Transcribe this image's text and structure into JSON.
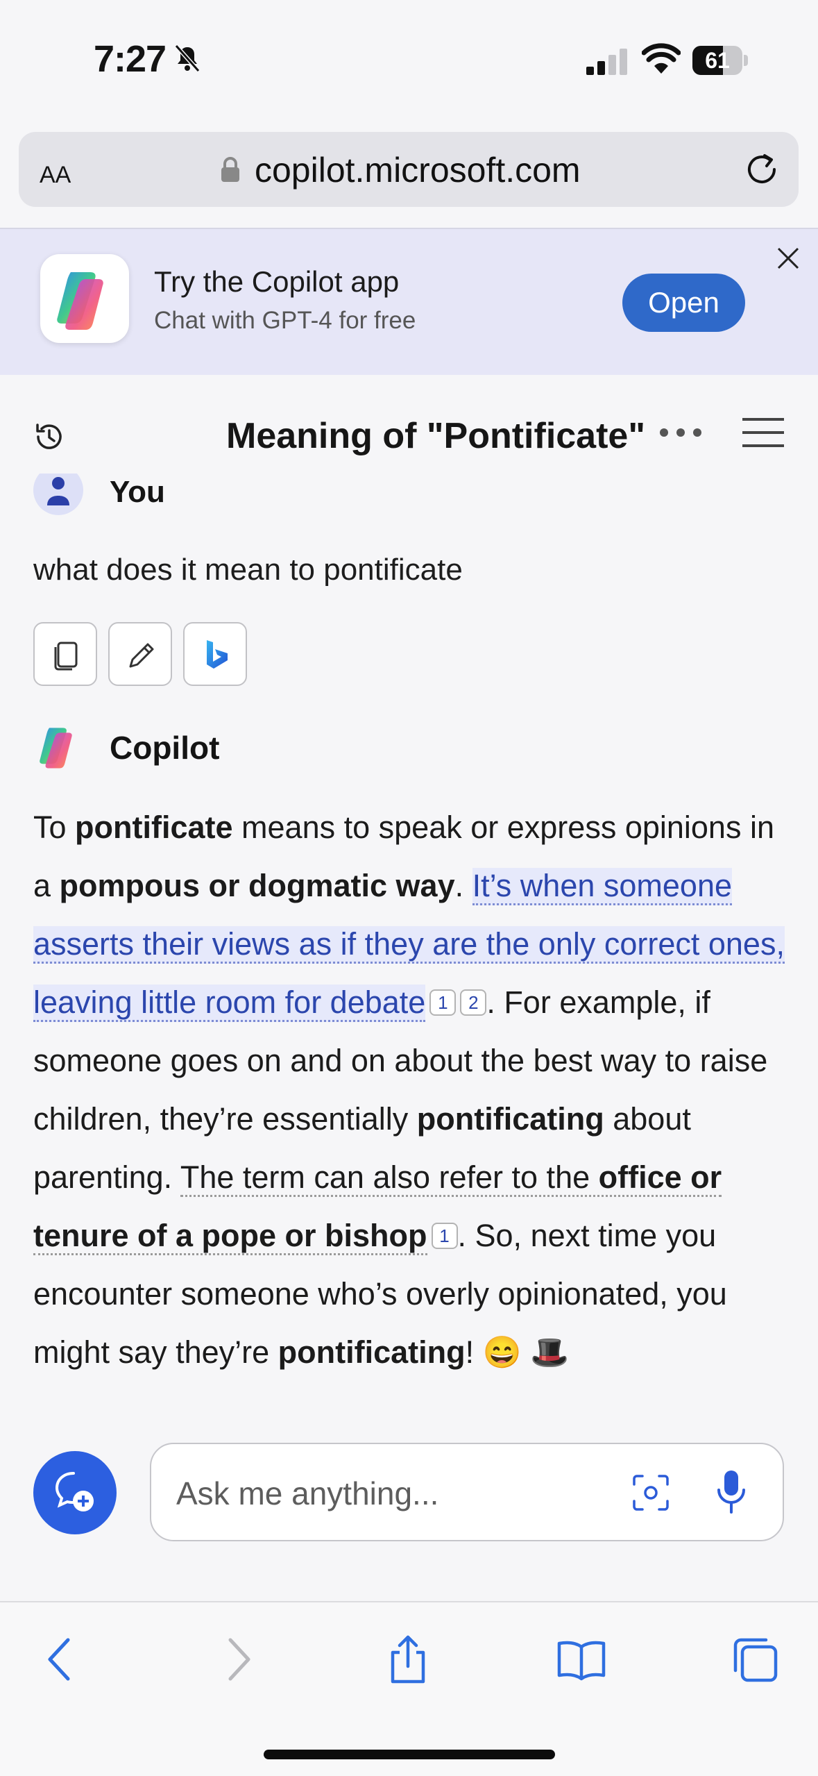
{
  "status_bar": {
    "time": "7:27",
    "battery": "61",
    "battery_level": 0.61
  },
  "browser": {
    "text_size_label": "AA",
    "url": "copilot.microsoft.com"
  },
  "banner": {
    "title": "Try the Copilot app",
    "subtitle": "Chat with GPT-4 for free",
    "open_label": "Open"
  },
  "chat": {
    "title": "Meaning of \"Pontificate\""
  },
  "user_message": {
    "author": "You",
    "text": "what does it mean to pontificate"
  },
  "copilot_message": {
    "author": "Copilot",
    "p1": "To ",
    "b1": "pontificate",
    "p2": " means to speak or express opinions in a ",
    "b2": "pompous or dogmatic way",
    "p3": ". ",
    "highlight": "It’s when someone asserts their views as if they are the only correct ones, leaving little room for debate",
    "cite1": "1",
    "cite2": "2",
    "p4": ". For example, if someone goes on and on about the best way to raise children, they’re essentially ",
    "b3": "pontificating",
    "p5": " about parenting. ",
    "u1": "The term can also refer to the ",
    "u1b": "office or tenure of a pope or bishop",
    "cite3": "1",
    "p6": ". So, next time you encounter someone who’s overly opinionated, you might say they’re ",
    "b4": "pontificating",
    "p7": "! 😄 🎩"
  },
  "composer": {
    "placeholder": "Ask me anything..."
  },
  "colors": {
    "accent": "#2f69c9",
    "link": "#2b46ad",
    "banner_bg": "#e6e6f7",
    "new_chat": "#2c5fe0"
  },
  "icons": [
    "bell-slash-icon",
    "signal-icon",
    "wifi-icon",
    "lock-icon",
    "reload-icon",
    "close-icon",
    "history-icon",
    "more-icon",
    "menu-icon",
    "copy-icon",
    "edit-icon",
    "bing-icon",
    "new-chat-icon",
    "camera-icon",
    "mic-icon",
    "back-icon",
    "forward-icon",
    "share-icon",
    "bookmarks-icon",
    "tabs-icon"
  ]
}
